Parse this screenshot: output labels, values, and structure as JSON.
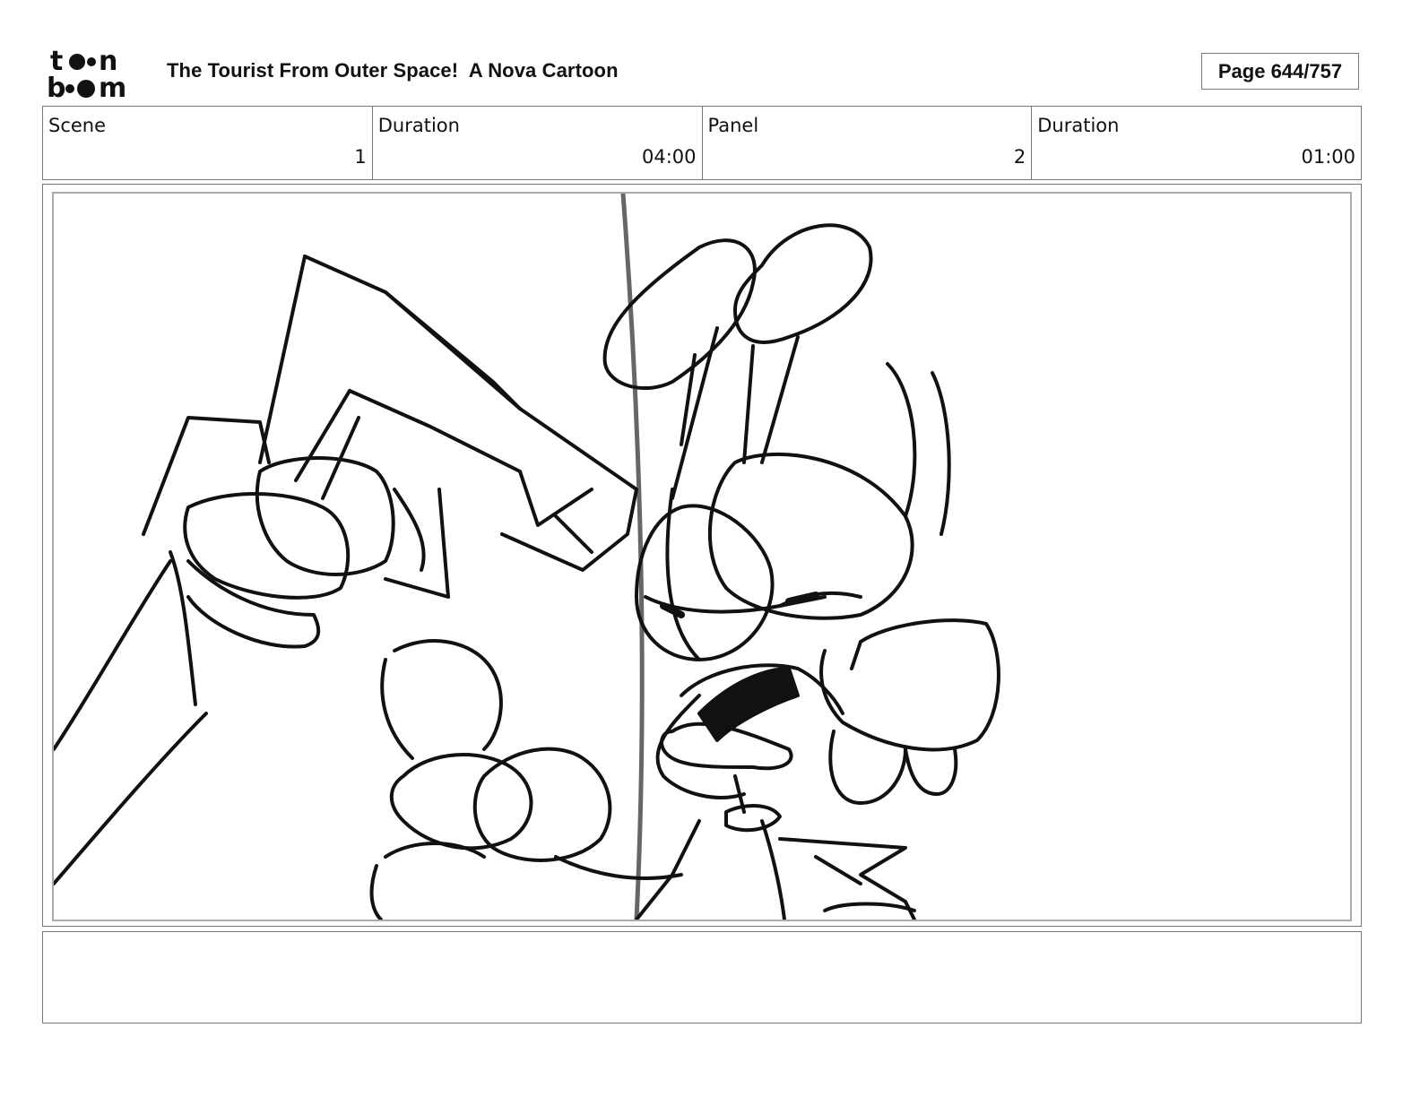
{
  "header": {
    "logo_text": "toon boom",
    "project_title": "The Tourist From Outer Space!  A Nova Cartoon",
    "page_label": "Page 644/757"
  },
  "info_bar": {
    "scene_label": "Scene",
    "scene_value": "1",
    "scene_duration_label": "Duration",
    "scene_duration_value": "04:00",
    "panel_label": "Panel",
    "panel_value": "2",
    "panel_duration_label": "Duration",
    "panel_duration_value": "01:00"
  },
  "panel": {
    "image_kind": "rough pencil sketch"
  },
  "notes": {
    "text": ""
  },
  "colors": {
    "border": "#777777",
    "inner_border": "#aaaaaa",
    "ink": "#111111",
    "guide_line": "#666666"
  }
}
